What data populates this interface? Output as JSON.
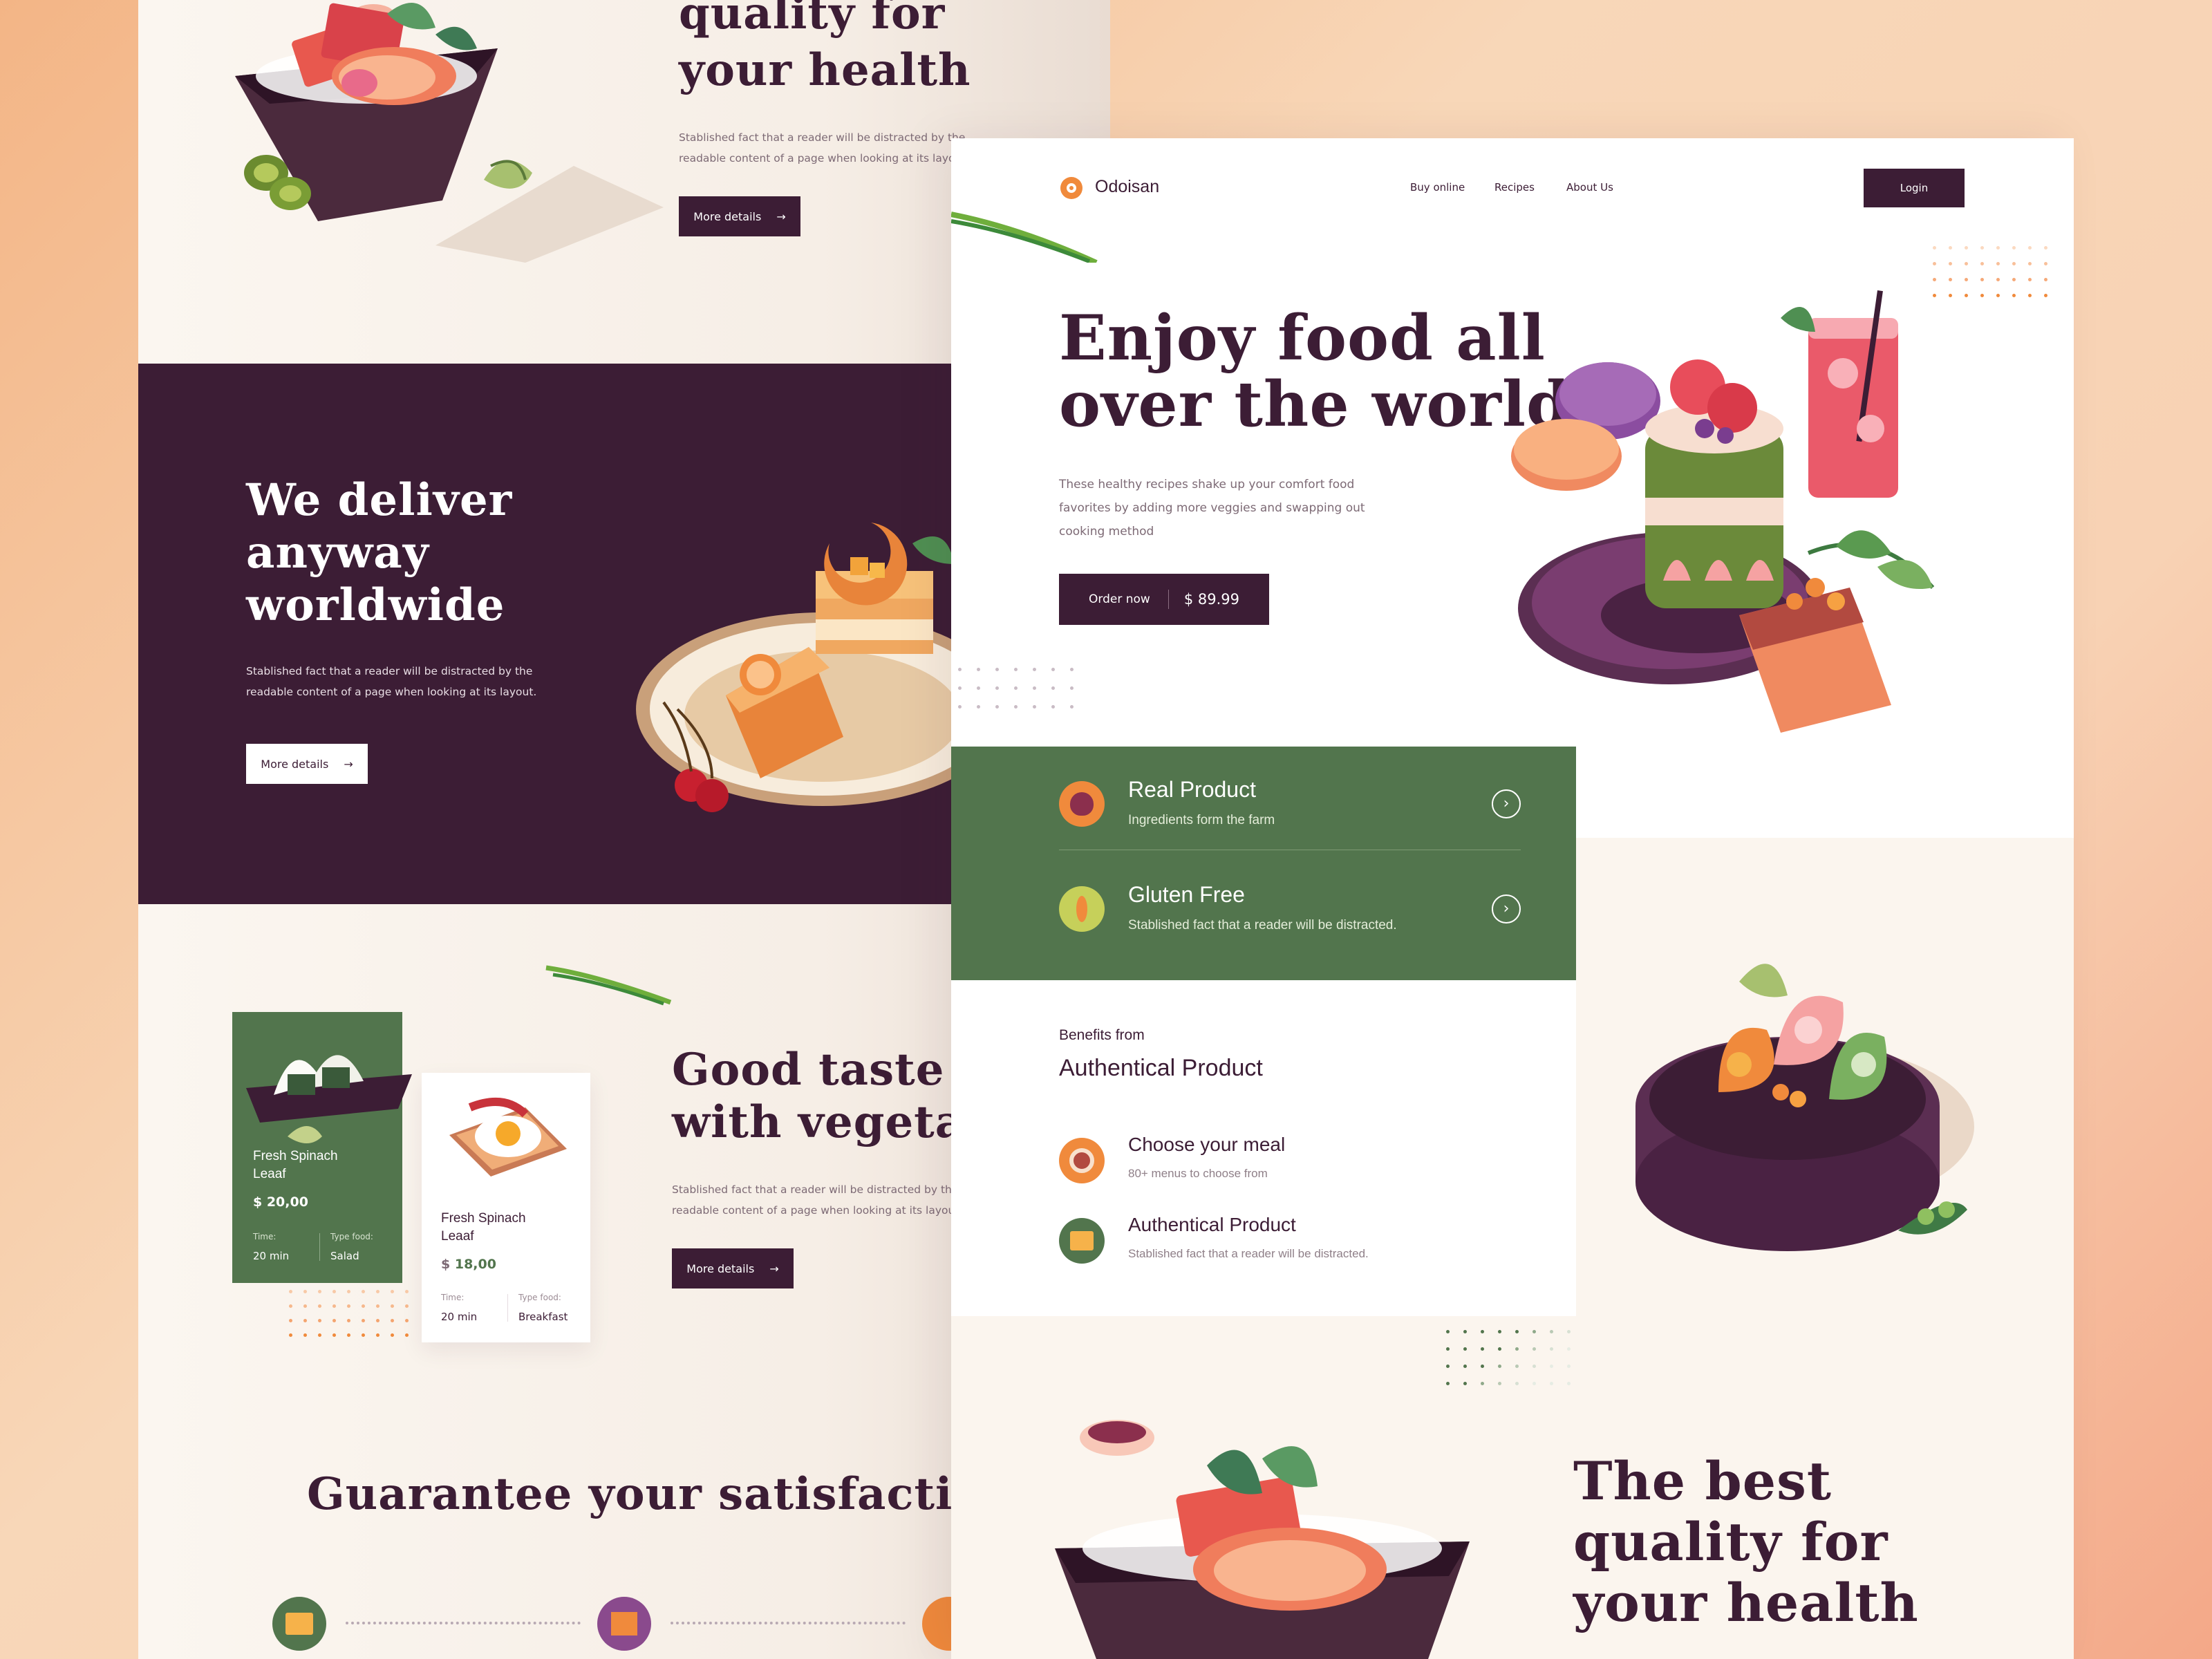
{
  "left_page": {
    "hero_title_line1": "quality for",
    "hero_title_line2": "your health",
    "hero_text_line1": "Stablished fact that a reader will be distracted by the",
    "hero_text_line2": "readable content of a page when looking at its layout.",
    "hero_button": "More details",
    "deliver_title_line1": "We deliver",
    "deliver_title_line2": "anyway",
    "deliver_title_line3": "worldwide",
    "deliver_text_line1": "Stablished fact that a reader will be distracted by the",
    "deliver_text_line2": "readable content of a page when looking at its layout.",
    "deliver_button": "More details",
    "taste_title_line1": "Good taste",
    "taste_title_line2": "with vegetab",
    "taste_text_line1": "Stablished fact that a reader will be distracted by the",
    "taste_text_line2": "readable content of a page when looking at its layout.",
    "taste_button": "More details",
    "card1": {
      "name_line1": "Fresh Spinach",
      "name_line2": "Leaaf",
      "price": "$ 20,00",
      "time_label": "Time:",
      "time_value": "20 min",
      "type_label": "Type food:",
      "type_value": "Salad"
    },
    "card2": {
      "name_line1": "Fresh Spinach",
      "name_line2": "Leaaf",
      "price_prefix": "$",
      "price": "18,00",
      "time_label": "Time:",
      "time_value": "20 min",
      "type_label": "Type food:",
      "type_value": "Breakfast"
    },
    "guarantee_title": "Guarantee your satisfaction"
  },
  "right_page": {
    "brand": "Odoisan",
    "nav": [
      "Buy online",
      "Recipes",
      "About Us"
    ],
    "login": "Login",
    "hero_title_line1": "Enjoy food all",
    "hero_title_line2": "over the world",
    "hero_text_line1": "These healthy recipes shake up your comfort food",
    "hero_text_line2": "favorites by adding more veggies and swapping out",
    "hero_text_line3": "cooking method",
    "order_label": "Order now",
    "order_price": "$ 89.99",
    "features": [
      {
        "title": "Real Product",
        "subtitle": "Ingredients form the farm"
      },
      {
        "title": "Gluten Free",
        "subtitle": "Stablished fact that a reader will be distracted."
      }
    ],
    "benefits_label": "Benefits from",
    "benefits_title": "Authentical Product",
    "benefits": [
      {
        "title": "Choose your meal",
        "subtitle": "80+ menus to choose from"
      },
      {
        "title": "Authentical Product",
        "subtitle": "Stablished fact that a reader will be distracted."
      }
    ],
    "bottom_title_line1": "The best",
    "bottom_title_line2": "quality for",
    "bottom_title_line3": "your health"
  },
  "colors": {
    "primary": "#3c1d35",
    "green": "#52754d",
    "orange": "#f08a3c",
    "cream": "#fbf5ee"
  }
}
